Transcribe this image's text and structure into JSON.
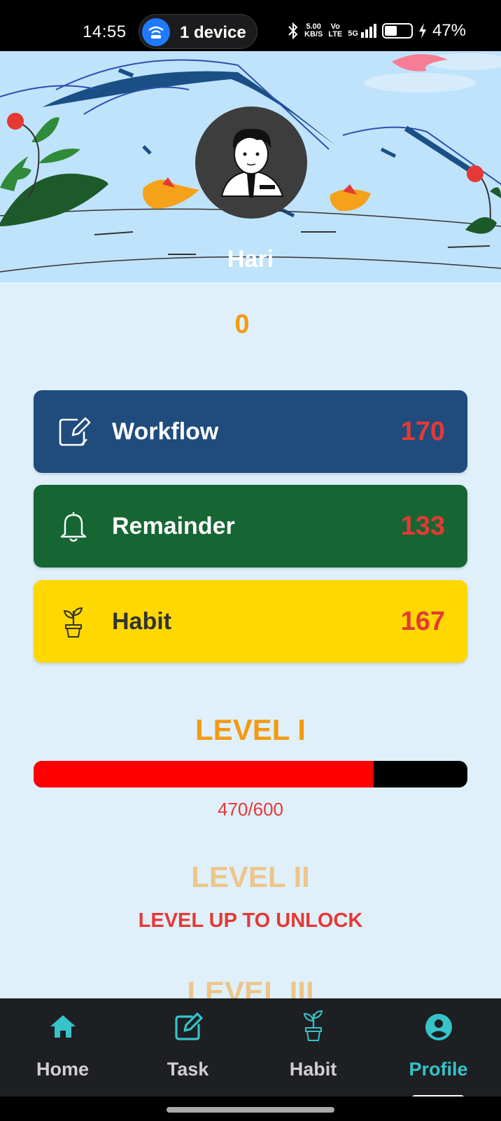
{
  "status_bar": {
    "time": "14:55",
    "device_label": "1 device",
    "net_speed_top": "5.00",
    "net_speed_bottom": "KB/S",
    "volte_top": "Vo",
    "volte_bottom": "LTE",
    "signal_label": "5G",
    "battery_percent": "47%",
    "battery_level": 0.47
  },
  "profile": {
    "name": "Hari",
    "points": "0"
  },
  "stats": [
    {
      "label": "Workflow",
      "count": "170",
      "icon": "edit-note-icon",
      "color": "#1f4c7d"
    },
    {
      "label": "Remainder",
      "count": "133",
      "icon": "bell-icon",
      "color": "#166634"
    },
    {
      "label": "Habit",
      "count": "167",
      "icon": "plant-pot-icon",
      "color": "#fed800"
    }
  ],
  "levels": {
    "level1": {
      "title": "LEVEL I",
      "progress_text": "470/600",
      "current": 470,
      "max": 600
    },
    "level2": {
      "title": "LEVEL II",
      "locked_text": "LEVEL UP TO UNLOCK"
    },
    "level3": {
      "title": "LEVEL III"
    }
  },
  "nav": {
    "items": [
      {
        "label": "Home",
        "icon": "home-icon"
      },
      {
        "label": "Task",
        "icon": "edit-icon"
      },
      {
        "label": "Habit",
        "icon": "plant-pot-icon"
      },
      {
        "label": "Profile",
        "icon": "account-circle-icon",
        "active": true
      }
    ]
  },
  "colors": {
    "accent_teal": "#36c3c9",
    "points_orange": "#f39a14",
    "count_red": "#e53935"
  }
}
